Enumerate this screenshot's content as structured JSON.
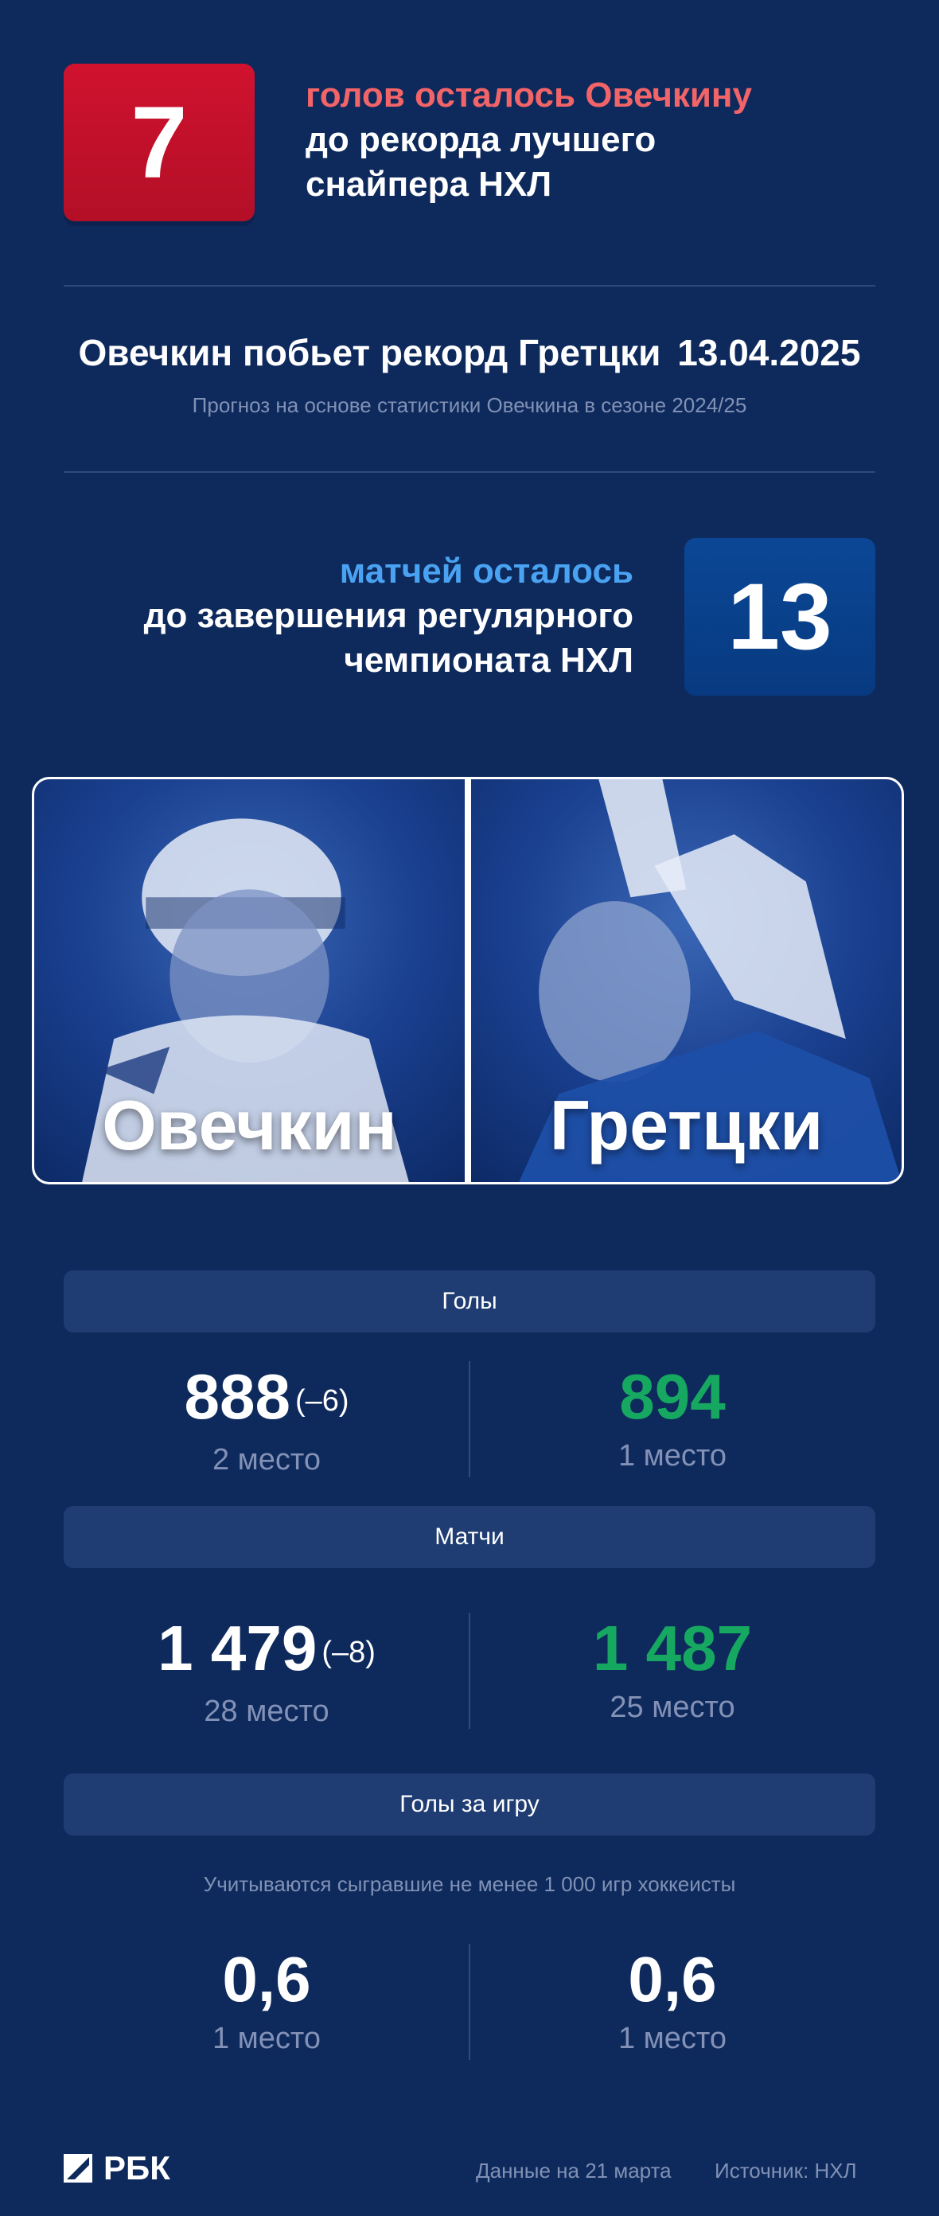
{
  "goals_card": {
    "number": "7",
    "line1": "голов осталось Овечкину",
    "line2": "до рекорда лучшего",
    "line3": "снайпера НХЛ"
  },
  "forecast": {
    "text": "Овечкин побьет рекорд Гретцки",
    "date": "13.04.2025",
    "note": "Прогноз на основе статистики Овечкина в сезоне 2024/25"
  },
  "matches_card": {
    "number": "13",
    "line1": "матчей осталось",
    "line2": "до завершения регулярного",
    "line3": "чемпионата НХЛ"
  },
  "players": {
    "left_name": "Овечкин",
    "right_name": "Гретцки"
  },
  "goals": {
    "title": "Голы",
    "left_value": "888",
    "left_diff": "(–6)",
    "left_place": "2 место",
    "right_value": "894",
    "right_place": "1 место"
  },
  "games": {
    "title": "Матчи",
    "left_value": "1 479",
    "left_diff": "(–8)",
    "left_place": "28 место",
    "right_value": "1 487",
    "right_place": "25 место"
  },
  "goals_per_game": {
    "title": "Голы за игру",
    "note": "Учитываются сыгравшие не менее 1 000 игр хоккеисты",
    "left_value": "0,6",
    "left_place": "1 место",
    "right_value": "0,6",
    "right_place": "1 место"
  },
  "footer": {
    "logo": "РБК",
    "date_note": "Данные на 21 марта",
    "source": "Источник: НХЛ"
  },
  "colors": {
    "background": "#0e2a5c",
    "red_card": "#c8102e",
    "blue_card": "#0b4796",
    "accent_red": "#f26468",
    "accent_blue": "#4aa3f2",
    "leader_green": "#16a860"
  }
}
